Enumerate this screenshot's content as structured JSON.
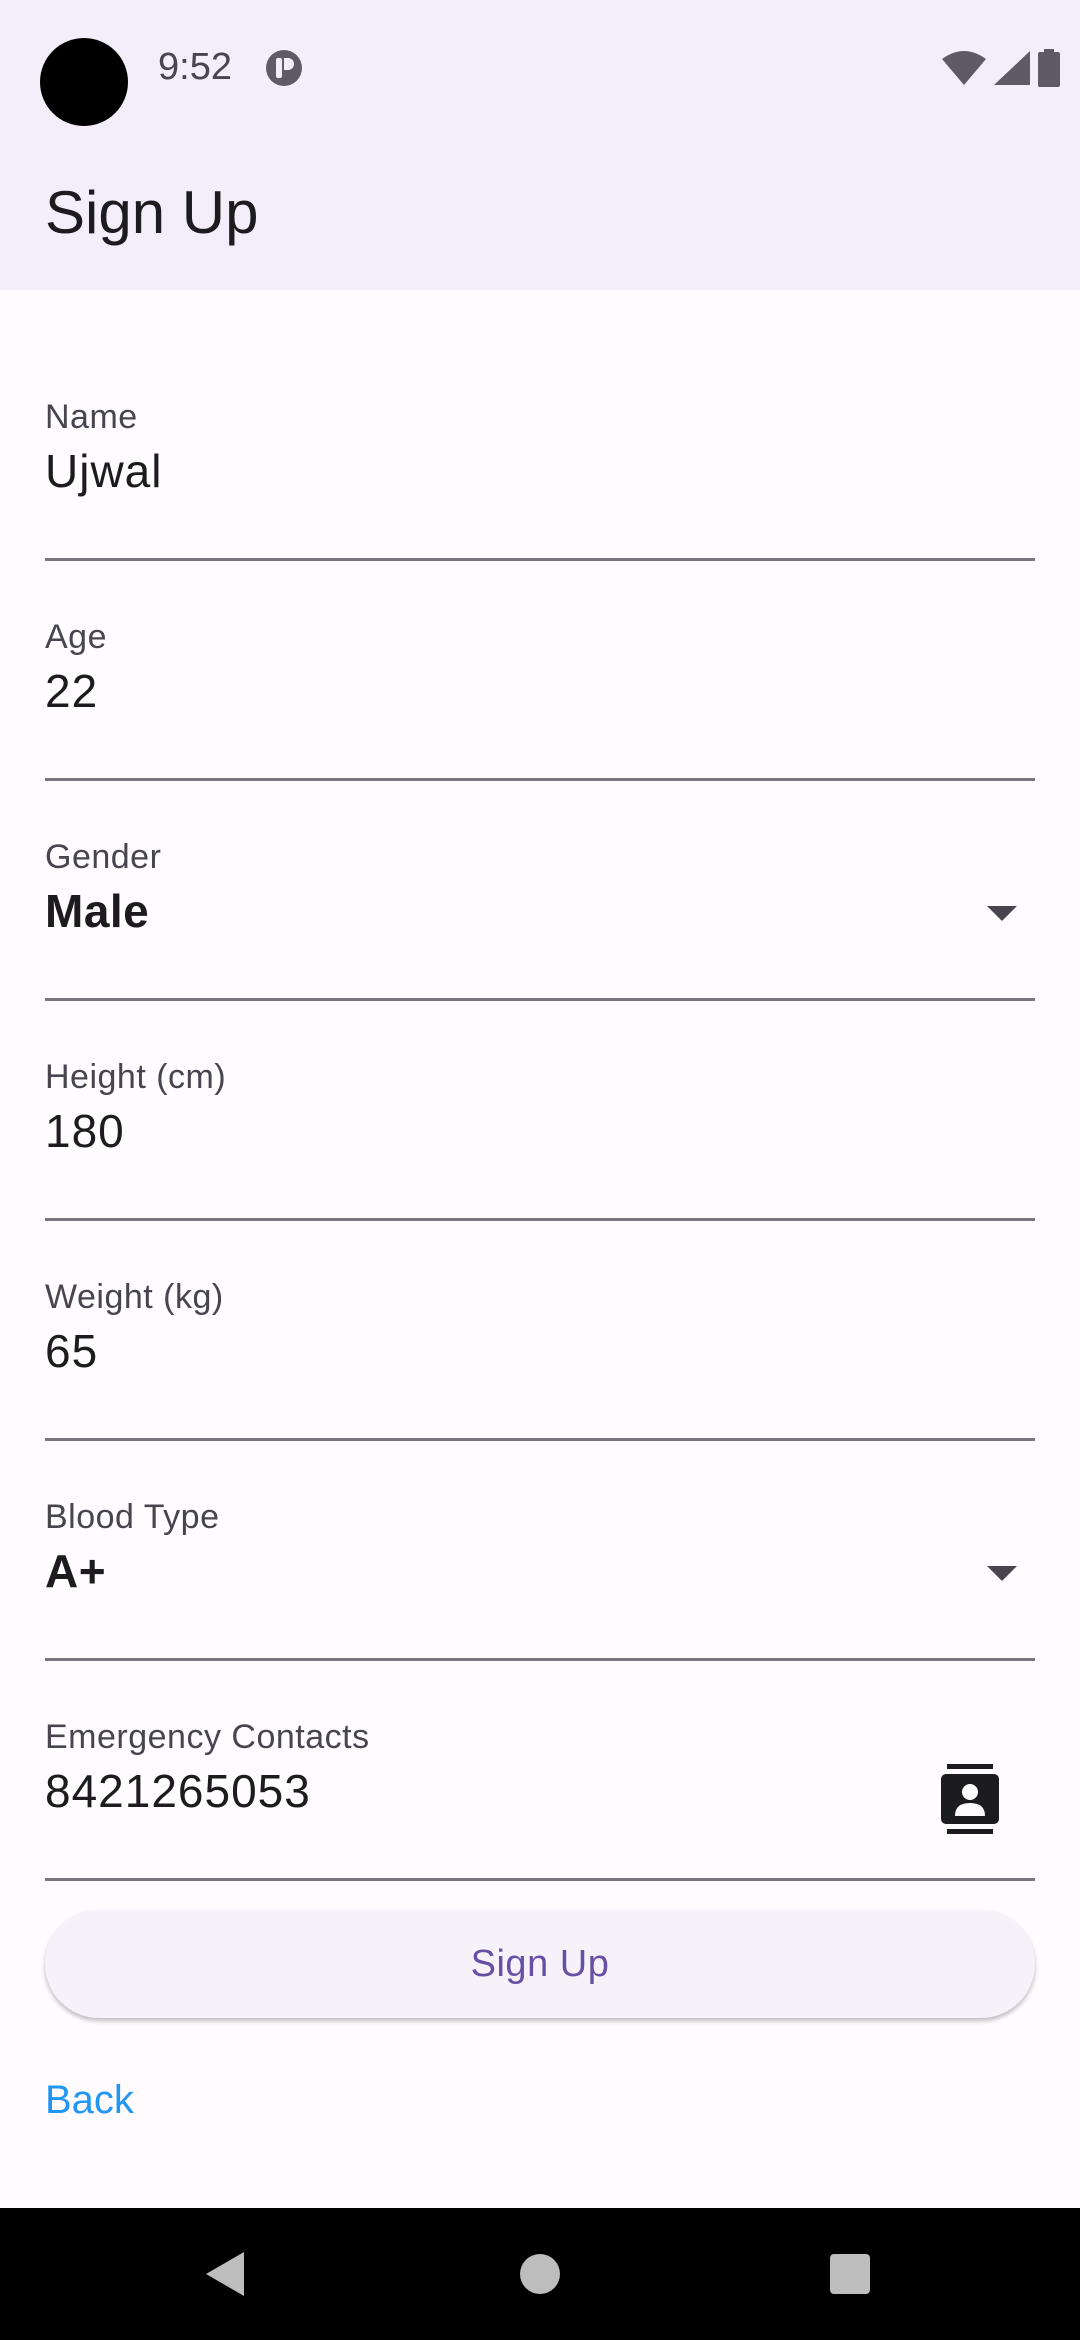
{
  "status_bar": {
    "time": "9:52",
    "icons": [
      "notification-icon",
      "wifi-icon",
      "signal-icon",
      "battery-icon"
    ]
  },
  "app_bar": {
    "title": "Sign Up"
  },
  "form": {
    "name": {
      "label": "Name",
      "value": "Ujwal"
    },
    "age": {
      "label": "Age",
      "value": "22"
    },
    "gender": {
      "label": "Gender",
      "value": "Male"
    },
    "height": {
      "label": "Height (cm)",
      "value": "180"
    },
    "weight": {
      "label": "Weight (kg)",
      "value": "65"
    },
    "blood_type": {
      "label": "Blood Type",
      "value": "A+"
    },
    "emergency_contacts": {
      "label": "Emergency Contacts",
      "value": "8421265053",
      "icon": "contacts-icon"
    }
  },
  "actions": {
    "signup_label": "Sign Up",
    "back_label": "Back"
  },
  "colors": {
    "accent": "#6750a4",
    "link": "#2196f3",
    "surface": "#f3eef9"
  },
  "nav_bar": {
    "icons": [
      "back-icon",
      "home-icon",
      "recents-icon"
    ]
  }
}
